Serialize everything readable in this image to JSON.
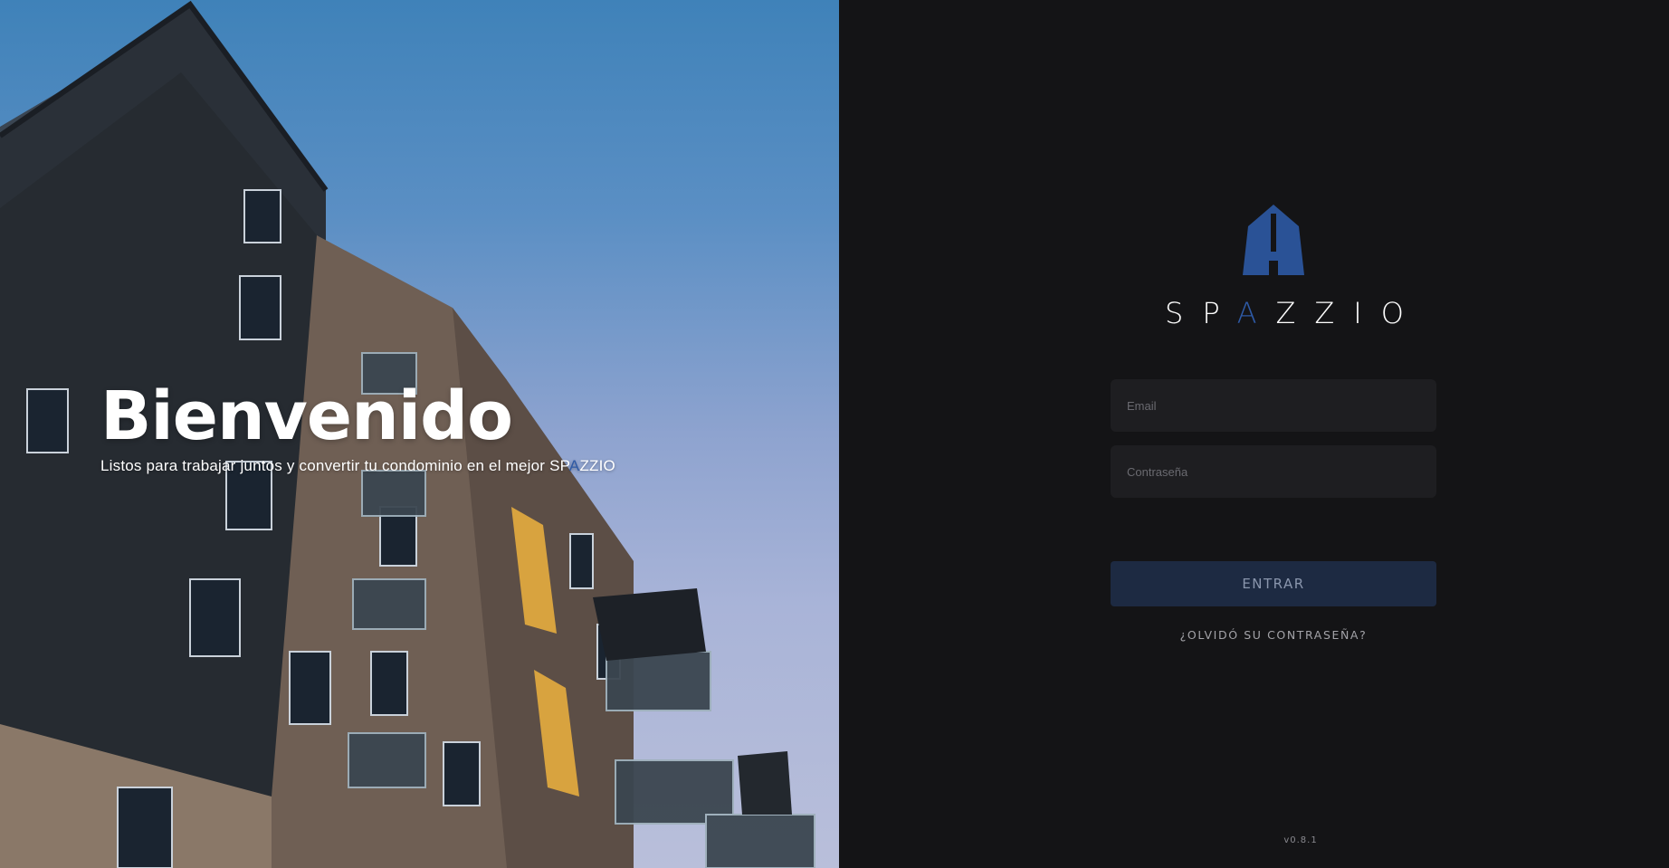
{
  "hero": {
    "title": "Bienvenido",
    "subtitle_prefix": "Listos para trabajar juntos y convertir tu condominio en el mejor ",
    "brand_part1": "SP",
    "brand_accent": "A",
    "brand_part2": "ZZIO"
  },
  "logo": {
    "word_part1": "SP",
    "word_accent": "A",
    "word_part2": "ZZIO",
    "icon": "building-icon",
    "accent_color": "#2e5aa6"
  },
  "form": {
    "email_placeholder": "Email",
    "email_value": "",
    "password_placeholder": "Contraseña",
    "password_value": "",
    "submit_label": "ENTRAR",
    "forgot_label": "¿OLVIDÓ SU CONTRASEÑA?"
  },
  "footer": {
    "version": "v0.8.1"
  },
  "colors": {
    "panel_bg": "#141416",
    "input_bg": "#1e1e21",
    "button_bg": "#1d2a42",
    "brand_blue": "#2e5aa6"
  }
}
